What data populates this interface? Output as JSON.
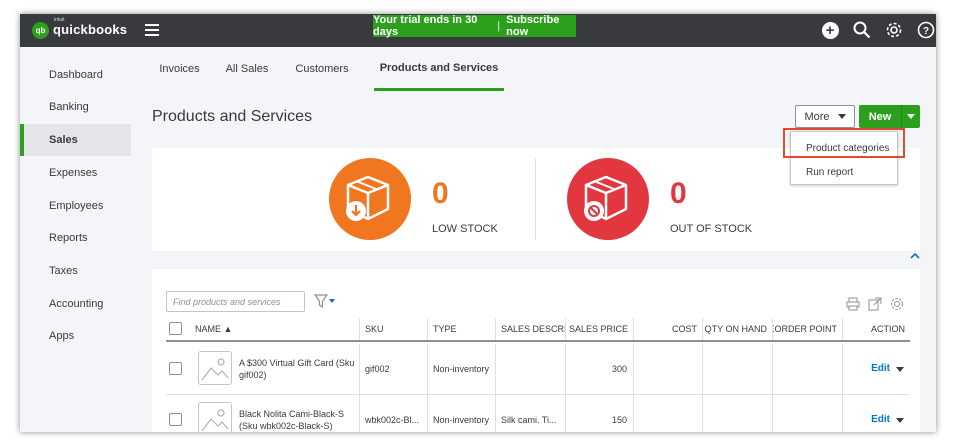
{
  "app": {
    "logo_small": "intuit",
    "logo_name": "quickbooks",
    "logo_mark": "qb"
  },
  "trial": {
    "text": "Your trial ends in 30 days",
    "separator": "|",
    "link": "Subscribe now"
  },
  "top_icons": [
    "plus-icon",
    "search-icon",
    "gear-icon",
    "help-icon"
  ],
  "sidebar": {
    "items": [
      {
        "label": "Dashboard"
      },
      {
        "label": "Banking"
      },
      {
        "label": "Sales",
        "active": true
      },
      {
        "label": "Expenses"
      },
      {
        "label": "Employees"
      },
      {
        "label": "Reports"
      },
      {
        "label": "Taxes"
      },
      {
        "label": "Accounting"
      },
      {
        "label": "Apps"
      }
    ]
  },
  "tabs": [
    {
      "label": "Invoices"
    },
    {
      "label": "All Sales"
    },
    {
      "label": "Customers"
    },
    {
      "label": "Products and Services",
      "active": true
    }
  ],
  "page": {
    "title": "Products and Services"
  },
  "actions": {
    "more_label": "More",
    "new_label": "New"
  },
  "more_menu": {
    "items": [
      {
        "label": "Product categories",
        "highlighted": true
      },
      {
        "label": "Run report"
      }
    ]
  },
  "stock": {
    "low": {
      "count": "0",
      "label": "LOW STOCK",
      "color": "#f0761f"
    },
    "out": {
      "count": "0",
      "label": "OUT OF STOCK",
      "color": "#e2373f"
    }
  },
  "table": {
    "search_placeholder": "Find products and services",
    "columns": [
      "NAME ▲",
      "SKU",
      "TYPE",
      "SALES DESCRIPT",
      "SALES PRICE",
      "COST",
      "QTY ON HAND",
      "REORDER POINT",
      "ACTION"
    ],
    "rows": [
      {
        "name": "A $300 Virtual Gift Card (Sku gif002)",
        "sku": "gif002",
        "type": "Non-inventory",
        "sales_desc": "",
        "sales_price": "300",
        "cost": "",
        "qty": "",
        "reorder": "",
        "action": "Edit"
      },
      {
        "name": "Black Nolita Cami-Black-S (Sku wbk002c-Black-S)",
        "sku": "wbk002c-Bl...",
        "type": "Non-inventory",
        "sales_desc": "Silk cami. Ti...",
        "sales_price": "150",
        "cost": "",
        "qty": "",
        "reorder": "",
        "action": "Edit"
      }
    ]
  },
  "colors": {
    "brand_green": "#2ca01c",
    "topbar": "#393a3d",
    "link_blue": "#0077c5",
    "highlight_red": "#e04a2f"
  }
}
